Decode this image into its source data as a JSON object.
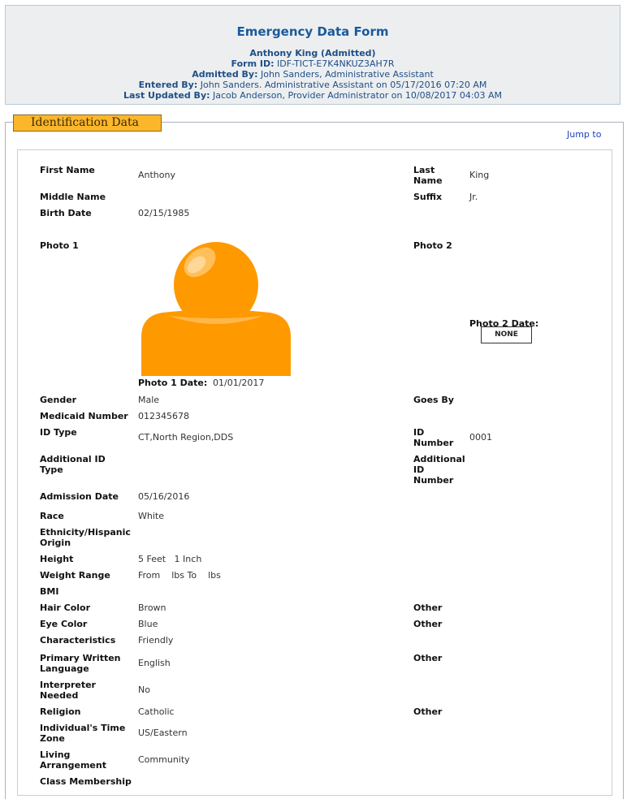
{
  "header": {
    "title": "Emergency Data Form",
    "individual": "Anthony King (Admitted)",
    "form_id_label": "Form ID:",
    "form_id": "IDF-TICT-E7K4NKUZ3AH7R",
    "admitted_by_label": "Admitted By:",
    "admitted_by": "John Sanders, Administrative Assistant",
    "entered_by_label": "Entered By:",
    "entered_by": "John Sanders. Administrative Assistant on 05/17/2016 07:20 AM",
    "updated_by_label": "Last Updated By:",
    "updated_by": "Jacob Anderson, Provider Administrator on 10/08/2017 04:03 AM"
  },
  "section": {
    "title": "Identification Data",
    "jump_to": "Jump to"
  },
  "labels": {
    "first_name": "First Name",
    "last_name_1": "Last",
    "last_name_2": "Name",
    "middle_name": "Middle Name",
    "suffix": "Suffix",
    "birth_date": "Birth Date",
    "photo1": "Photo 1",
    "photo2": "Photo 2",
    "photo1_date": "Photo 1 Date:",
    "photo2_date": "Photo 2 Date:",
    "gender": "Gender",
    "goes_by": "Goes By",
    "medicaid": "Medicaid Number",
    "id_type": "ID Type",
    "id_number_1": "ID",
    "id_number_2": "Number",
    "add_id_type_1": "Additional ID",
    "add_id_type_2": "Type",
    "add_id_number_1": "Additional",
    "add_id_number_2": "ID",
    "add_id_number_3": "Number",
    "admission_date": "Admission Date",
    "race": "Race",
    "ethnicity_1": "Ethnicity/Hispanic",
    "ethnicity_2": "Origin",
    "height": "Height",
    "weight_range": "Weight Range",
    "bmi": "BMI",
    "hair_color": "Hair Color",
    "eye_color": "Eye Color",
    "characteristics": "Characteristics",
    "language_1": "Primary Written",
    "language_2": "Language",
    "interpreter_1": "Interpreter",
    "interpreter_2": "Needed",
    "religion": "Religion",
    "timezone_1": "Individual's Time",
    "timezone_2": "Zone",
    "living_1": "Living",
    "living_2": "Arrangement",
    "class_membership": "Class Membership",
    "other": "Other"
  },
  "values": {
    "first_name": "Anthony",
    "last_name": "King",
    "suffix": "Jr.",
    "birth_date": "02/15/1985",
    "photo1_date": "01/01/2017",
    "photo2_button": "NONE",
    "gender": "Male",
    "medicaid": "012345678",
    "id_type": "CT,North Region,DDS",
    "id_number": "0001",
    "admission_date": "05/16/2016",
    "race": "White",
    "height": "5 Feet   1 Inch",
    "weight_range": "From    lbs To    lbs",
    "hair_color": "Brown",
    "eye_color": "Blue",
    "characteristics": "Friendly",
    "language": "English",
    "interpreter": "No",
    "religion": "Catholic",
    "timezone": "US/Eastern",
    "living": "Community"
  },
  "colors": {
    "header_bg": "#eceef0",
    "header_text": "#1f4f86",
    "tab_bg": "#fbb62a",
    "avatar": "#ff9900",
    "link": "#1f3fbf"
  },
  "icons": {
    "photo1": "person-silhouette-icon"
  }
}
